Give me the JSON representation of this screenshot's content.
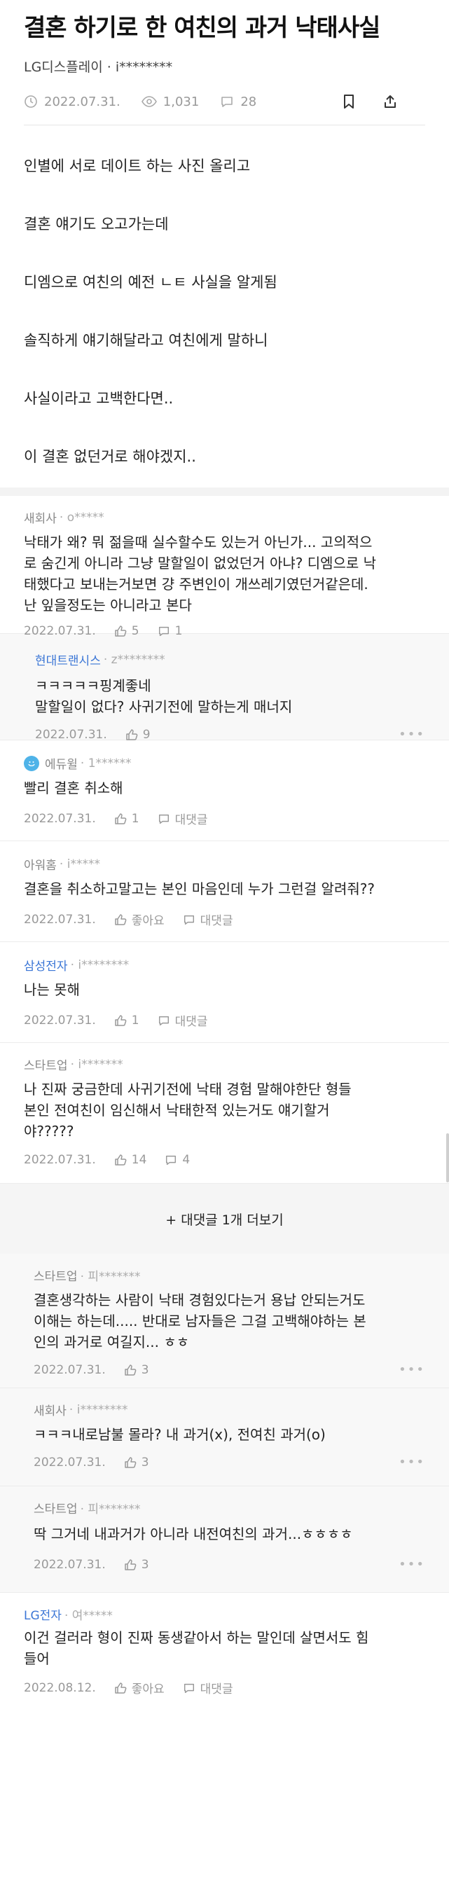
{
  "post": {
    "title": "결혼 하기로 한 여친의 과거 낙태사실",
    "author": "LG디스플레이 · i********",
    "date": "2022.07.31.",
    "views": "1,031",
    "comments": "28",
    "body": [
      "인별에 서로 데이트 하는 사진 올리고",
      "결혼 얘기도 오고가는데",
      "디엠으로 여친의 예전 ㄴㅌ 사실을 알게됨",
      "솔직하게 얘기해달라고 여친에게 말하니",
      "사실이라고 고백한다면..",
      "이 결혼 없던거로 해야겠지.."
    ]
  },
  "comments": [
    {
      "company": "새회사",
      "uid": "· o*****",
      "lines": [
        "낙태가 왜? 뭐 젊을때 실수할수도 있는거 아닌가... 고의적으",
        "로 숨긴게 아니라 그냥 말할일이 없었던거 아냐? 디엠으로 낙",
        "태했다고 보내는거보면 걍 주변인이 개쓰레기였던거같은데.",
        "난 잎을정도는 아니라고 본다"
      ],
      "date": "2022.07.31.",
      "likes": "5",
      "replies": "1"
    },
    {
      "company": "현대트랜시스",
      "uid": "· z********",
      "lines": [
        "ㅋㅋㅋㅋㅋ핑계좋네",
        "말할일이 없다? 사귀기전에 말하는게 매너지"
      ],
      "date": "2022.07.31.",
      "likes": "9"
    },
    {
      "company": "에듀윌",
      "uid": "· 1******",
      "lines": [
        "빨리 결혼 취소해"
      ],
      "date": "2022.07.31.",
      "likes": "1",
      "replies": "대댓글"
    },
    {
      "company": "아워홈",
      "uid": "· i*****",
      "lines": [
        "결혼을 취소하고말고는 본인 마음인데 누가 그런걸 알려줘??"
      ],
      "date": "2022.07.31.",
      "likes": "좋아요",
      "replies": "대댓글"
    },
    {
      "company": "삼성전자",
      "uid": "· i********",
      "lines": [
        "나는 못해"
      ],
      "date": "2022.07.31.",
      "likes": "1",
      "replies": "대댓글"
    },
    {
      "company": "스타트업",
      "uid": "· i*******",
      "lines": [
        "나 진짜 궁금한데 사귀기전에 낙태 경험 말해야한단 형들",
        "본인 전여친이 임신해서 낙태한적 있는거도 얘기할거",
        "야?????"
      ],
      "date": "2022.07.31.",
      "likes": "14",
      "replies": "4"
    },
    {
      "more": "+ 대댓글 1개 더보기"
    },
    {
      "company": "스타트업",
      "uid": "· 피*******",
      "lines": [
        "결혼생각하는 사람이 낙태 경험있다는거 용납 안되는거도",
        "이해는 하는데..... 반대로 남자들은 그걸 고백해야하는 본",
        "인의 과거로 여길지... ㅎㅎ"
      ],
      "date": "2022.07.31.",
      "likes": "3"
    },
    {
      "company": "새회사",
      "uid": "· i********",
      "lines": [
        "ㅋㅋㅋ내로남불 몰라? 내 과거(x), 전여친 과거(o)"
      ],
      "date": "2022.07.31.",
      "likes": "3"
    },
    {
      "company": "스타트업",
      "uid": "· 피*******",
      "lines": [
        "딱 그거네 내과거가 아니라 내전여친의 과거...ㅎㅎㅎㅎ"
      ],
      "date": "2022.07.31.",
      "likes": "3"
    },
    {
      "company": "LG전자",
      "uid": "· 여*****",
      "lines": [
        "이건 걸러라 형이 진짜 동생같아서 하는 말인데 살면서도 힘",
        "들어"
      ],
      "date": "2022.08.12.",
      "likes": "좋아요",
      "replies": "대댓글"
    }
  ],
  "colors": {
    "accent_blue": "#3b76d6",
    "meta_gray": "#999999"
  },
  "icons": [
    "clock-icon",
    "eye-icon",
    "comment-icon",
    "bookmark-icon",
    "share-icon",
    "thumb-up-icon",
    "more-dots-icon"
  ]
}
